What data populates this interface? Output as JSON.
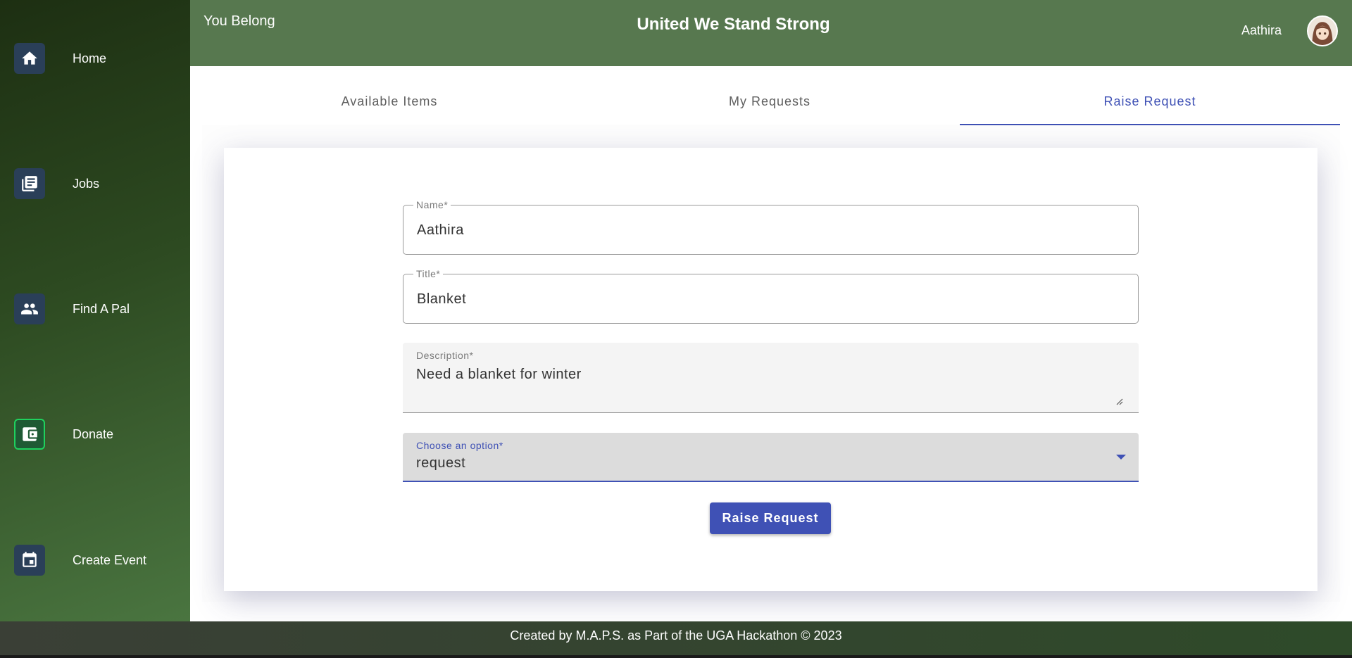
{
  "header": {
    "brand": "You Belong",
    "title": "United We Stand Strong",
    "username": "Aathira"
  },
  "sidebar": {
    "items": [
      {
        "label": "Home",
        "icon": "home-icon"
      },
      {
        "label": "Jobs",
        "icon": "newspaper-icon"
      },
      {
        "label": "Find A Pal",
        "icon": "people-icon"
      },
      {
        "label": "Donate",
        "icon": "wallet-icon",
        "active": true
      },
      {
        "label": "Create Event",
        "icon": "calendar-icon"
      }
    ]
  },
  "tabs": [
    {
      "label": "Available Items"
    },
    {
      "label": "My Requests"
    },
    {
      "label": "Raise Request",
      "active": true
    }
  ],
  "form": {
    "name": {
      "label": "Name*",
      "value": "Aathira"
    },
    "title": {
      "label": "Title*",
      "value": "Blanket"
    },
    "description": {
      "label": "Description*",
      "value": "Need a blanket for winter"
    },
    "option": {
      "label": "Choose an option*",
      "value": "request"
    },
    "submit_label": "Raise Request"
  },
  "footer": {
    "text": "Created by M.A.P.S. as Part of the UGA Hackathon © 2023"
  },
  "colors": {
    "header": "#57784f",
    "accent": "#3f51b5",
    "sidebar_icon_bg": "#2a3f58",
    "active_icon_border": "#1fd15e"
  }
}
